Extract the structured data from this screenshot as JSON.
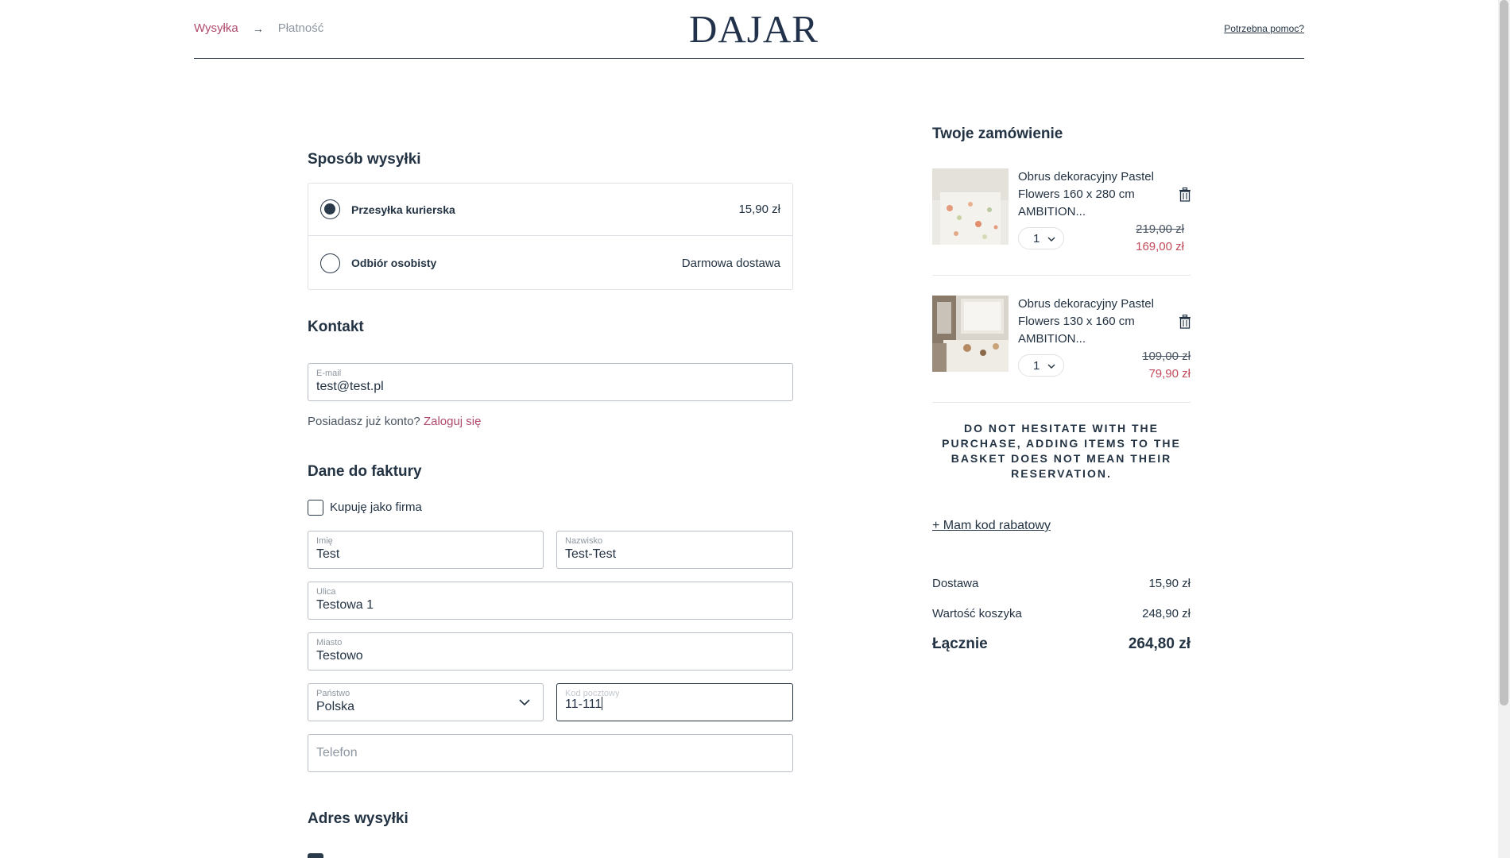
{
  "header": {
    "breadcrumb_step1": "Wysyłka",
    "breadcrumb_arrow": "→",
    "breadcrumb_step2": "Płatność",
    "logo": "DAJAR",
    "help_link": "Potrzebna pomoc?"
  },
  "shipping": {
    "title": "Sposób wysyłki",
    "options": [
      {
        "label": "Przesyłka kurierska",
        "price": "15,90 zł",
        "selected": true
      },
      {
        "label": "Odbiór osobisty",
        "price": "Darmowa dostawa",
        "selected": false
      }
    ]
  },
  "contact": {
    "title": "Kontakt",
    "email_label": "E-mail",
    "email_value": "test@test.pl",
    "account_text": "Posiadasz już konto?",
    "login_link": "Zaloguj się"
  },
  "invoice": {
    "title": "Dane do faktury",
    "company_checkbox_label": "Kupuję jako firma",
    "first_name_label": "Imię",
    "first_name_value": "Test",
    "last_name_label": "Nazwisko",
    "last_name_value": "Test-Test",
    "street_label": "Ulica",
    "street_value": "Testowa 1",
    "city_label": "Miasto",
    "city_value": "Testowo",
    "country_label": "Państwo",
    "country_value": "Polska",
    "postal_label": "Kod pocztowy",
    "postal_value": "11-111",
    "phone_placeholder": "Telefon"
  },
  "delivery": {
    "title": "Adres wysyłki"
  },
  "order": {
    "title": "Twoje zamówienie",
    "items": [
      {
        "name": "Obrus dekoracyjny Pastel Flowers 160 x 280 cm AMBITION...",
        "qty": "1",
        "old_price": "219,00 zł",
        "new_price": "169,00 zł"
      },
      {
        "name": "Obrus dekoracyjny Pastel Flowers 130 x 160 cm AMBITION...",
        "qty": "1",
        "old_price": "109,00 zł",
        "new_price": "79,90 zł"
      }
    ],
    "notice": "DO NOT HESITATE WITH THE PURCHASE, ADDING ITEMS TO THE BASKET DOES NOT MEAN THEIR RESERVATION.",
    "discount_link": "+ Mam kod rabatowy",
    "delivery_label": "Dostawa",
    "delivery_value": "15,90 zł",
    "cart_label": "Wartość koszyka",
    "cart_value": "248,90 zł",
    "total_label": "Łącznie",
    "total_value": "264,80 zł"
  },
  "colors": {
    "accent": "#b04a6a",
    "sale": "#c24a5a",
    "text": "#233343"
  }
}
